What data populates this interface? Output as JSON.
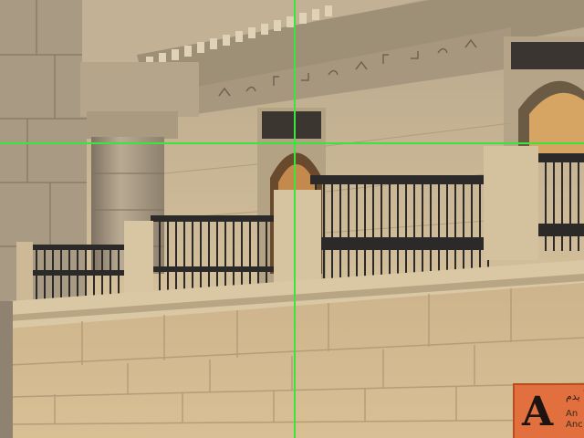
{
  "hud": {
    "crosshair_color": "#39e639"
  },
  "sign": {
    "letter": "A",
    "arabic_text": "أ يدم",
    "sub_line1": "An",
    "sub_line2": "Anc",
    "background_color": "#e2703e"
  },
  "scene": {
    "description_icon": "egyptian-temple-balcony-scene"
  }
}
